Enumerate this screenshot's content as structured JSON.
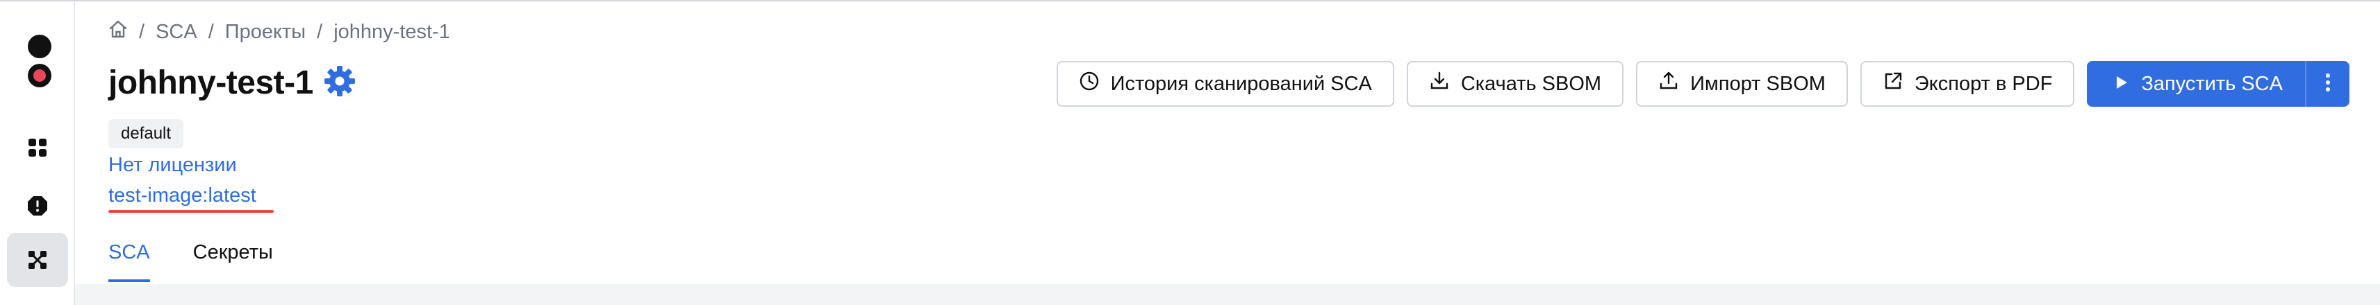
{
  "breadcrumb": {
    "home_icon": "home-icon",
    "items": [
      "SCA",
      "Проекты",
      "johhny-test-1"
    ],
    "separator": "/"
  },
  "project": {
    "title": "johhny-test-1",
    "settings_icon": "gear-icon",
    "tag": "default",
    "license_link": "Нет лицензии",
    "image_link": "test-image:latest"
  },
  "actions": {
    "history": "История сканирований SCA",
    "download_sbom": "Скачать SBOM",
    "import_sbom": "Импорт SBOM",
    "export_pdf": "Экспорт в PDF",
    "run_sca": "Запустить SCA"
  },
  "tabs": [
    {
      "label": "SCA",
      "active": true
    },
    {
      "label": "Секреты",
      "active": false
    }
  ],
  "sidebar": {
    "icons": [
      "logo-dot",
      "status-dot",
      "dashboard-icon",
      "alert-icon",
      "projects-icon"
    ],
    "active": "projects-icon"
  },
  "colors": {
    "accent": "#2f6de1",
    "underline_highlight": "#e24b4b",
    "status_dot": "#e8465a"
  }
}
